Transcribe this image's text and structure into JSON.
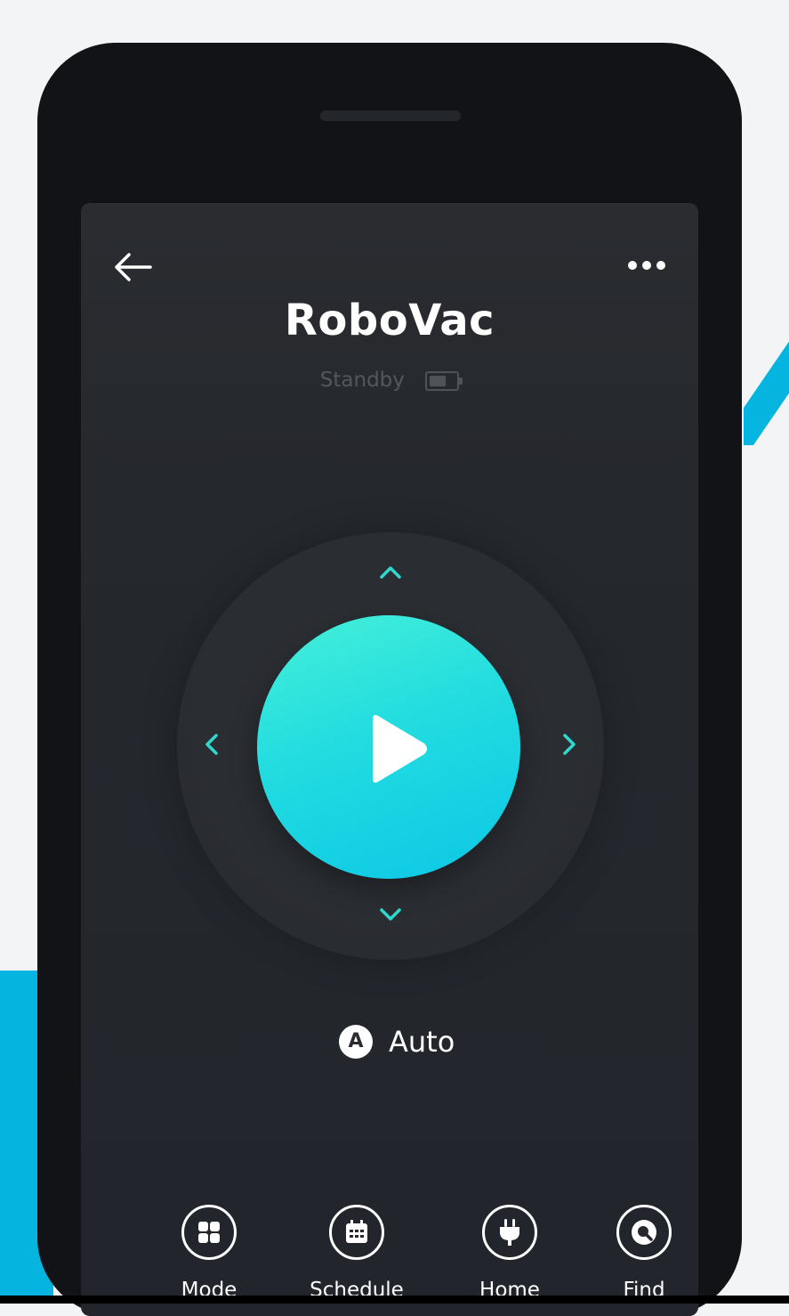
{
  "colors": {
    "accent": "#22dce0",
    "accent_light": "#46f0d8",
    "background_stripe": "#05b5df",
    "screen_bg": "#25282d"
  },
  "header": {
    "back_icon": "arrow-left-icon",
    "more_icon": "more-dots-icon",
    "title": "RoboVac",
    "status": "Standby",
    "battery_icon": "battery-icon"
  },
  "controls": {
    "up_icon": "chevron-up-icon",
    "down_icon": "chevron-down-icon",
    "left_icon": "chevron-left-icon",
    "right_icon": "chevron-right-icon",
    "play_icon": "play-icon"
  },
  "mode": {
    "badge": "A",
    "label": "Auto"
  },
  "bottom_nav": [
    {
      "label": "Mode",
      "icon": "grid-icon"
    },
    {
      "label": "Schedule",
      "icon": "calendar-icon"
    },
    {
      "label": "Home",
      "icon": "plug-icon"
    },
    {
      "label": "Find",
      "icon": "search-icon"
    }
  ]
}
